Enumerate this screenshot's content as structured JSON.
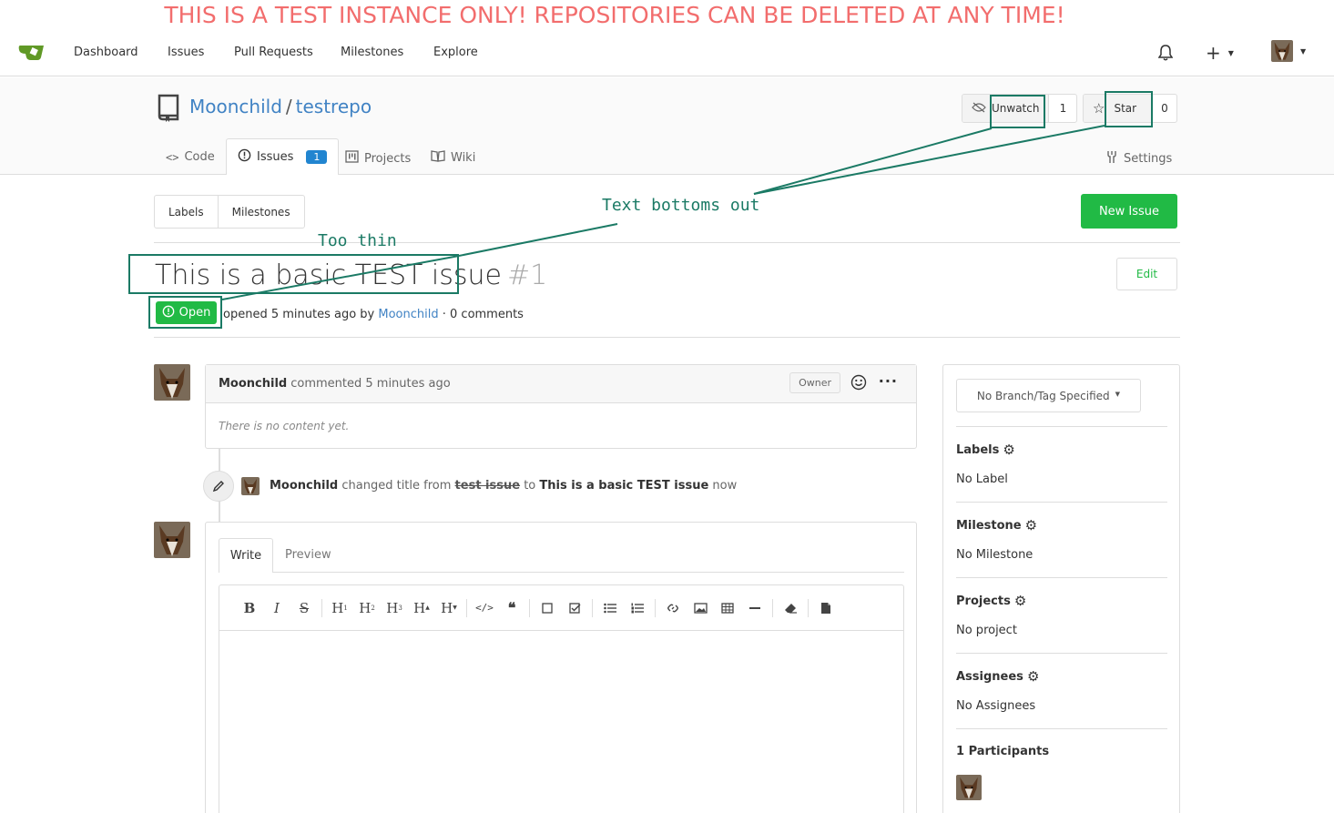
{
  "banner": "THIS IS A TEST INSTANCE ONLY! REPOSITORIES CAN BE DELETED AT ANY TIME!",
  "nav": {
    "items": [
      "Dashboard",
      "Issues",
      "Pull Requests",
      "Milestones",
      "Explore"
    ],
    "plus": "+"
  },
  "repo": {
    "owner": "Moonchild",
    "separator": "/",
    "name": "testrepo",
    "unwatch_label": "Unwatch",
    "watch_count": "1",
    "star_label": "Star",
    "star_count": "0",
    "tabs": {
      "code": "Code",
      "issues": "Issues",
      "issues_count": "1",
      "projects": "Projects",
      "wiki": "Wiki",
      "settings": "Settings"
    }
  },
  "filters": {
    "labels": "Labels",
    "milestones": "Milestones",
    "new_issue": "New Issue"
  },
  "issue": {
    "title": "This is a basic TEST issue",
    "number": "#1",
    "edit": "Edit",
    "status": "Open",
    "meta_opened": "opened 5 minutes ago by",
    "meta_author": "Moonchild",
    "meta_comments": "· 0 comments"
  },
  "comment": {
    "author": "Moonchild",
    "action": "commented 5 minutes ago",
    "owner_badge": "Owner",
    "more": "···",
    "body": "There is no content yet."
  },
  "event": {
    "author": "Moonchild",
    "text1": "changed title from",
    "old_title": "test issue",
    "text2": "to",
    "new_title": "This is a basic TEST issue",
    "time": "now"
  },
  "editor": {
    "write_tab": "Write",
    "preview_tab": "Preview",
    "tool_bold": "B",
    "tool_italic": "I",
    "tool_strike": "S",
    "tool_h1": "H",
    "tool_h1_sub": "1",
    "tool_h2": "H",
    "tool_h2_sub": "2",
    "tool_h3": "H",
    "tool_h3_sub": "3",
    "tool_hbig": "H",
    "tool_hbig_sub": "▲",
    "tool_hsmall": "H",
    "tool_hsmall_sub": "▼"
  },
  "sidebar": {
    "branch": "No Branch/Tag Specified",
    "labels_title": "Labels",
    "labels_value": "No Label",
    "milestone_title": "Milestone",
    "milestone_value": "No Milestone",
    "projects_title": "Projects",
    "projects_value": "No project",
    "assignees_title": "Assignees",
    "assignees_value": "No Assignees",
    "participants_title": "1 Participants"
  },
  "annotations": {
    "too_thin": "Too thin",
    "text_bottoms_out": "Text bottoms out"
  },
  "colors": {
    "accent_blue": "#4183c4",
    "green": "#21ba45",
    "annotation": "#1b7a65",
    "banner": "#f26d6d"
  }
}
